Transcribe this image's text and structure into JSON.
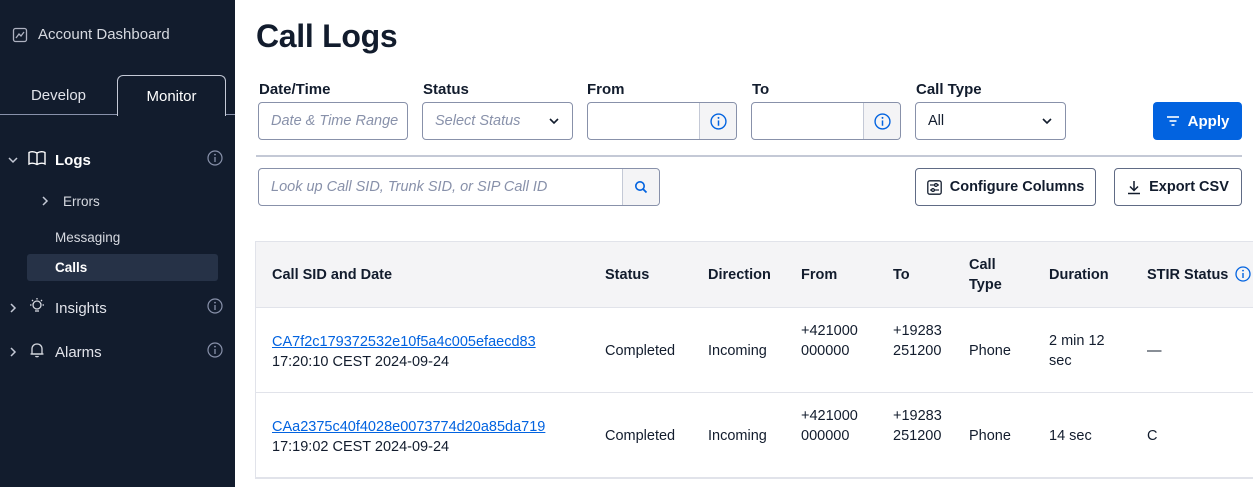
{
  "sidebar": {
    "account_dashboard": "Account Dashboard",
    "tabs": {
      "develop": "Develop",
      "monitor": "Monitor"
    },
    "logs": "Logs",
    "errors": "Errors",
    "messaging": "Messaging",
    "calls": "Calls",
    "insights": "Insights",
    "alarms": "Alarms"
  },
  "page": {
    "title": "Call Logs"
  },
  "filters": {
    "datetime": {
      "label": "Date/Time",
      "placeholder": "Date & Time Range"
    },
    "status": {
      "label": "Status",
      "placeholder": "Select Status"
    },
    "from": {
      "label": "From",
      "value": ""
    },
    "to": {
      "label": "To",
      "value": ""
    },
    "call_type": {
      "label": "Call Type",
      "value": "All"
    },
    "apply_label": "Apply"
  },
  "search": {
    "placeholder": "Look up Call SID, Trunk SID, or SIP Call ID"
  },
  "toolbar": {
    "configure_columns": "Configure Columns",
    "export_csv": "Export CSV"
  },
  "table": {
    "headers": {
      "sid_date": "Call SID and Date",
      "status": "Status",
      "direction": "Direction",
      "from": "From",
      "to": "To",
      "call_type": "Call Type",
      "duration": "Duration",
      "stir_status": "STIR Status"
    },
    "rows": [
      {
        "sid": "CA7f2c179372532e10f5a4c005efaecd83",
        "date": "17:20:10 CEST 2024-09-24",
        "status": "Completed",
        "direction": "Incoming",
        "from": "+421000000000",
        "to": "+19283251200",
        "call_type": "Phone",
        "duration": "2 min 12 sec",
        "stir_status": "—"
      },
      {
        "sid": "CAa2375c40f4028e0073774d20a85da719",
        "date": "17:19:02 CEST 2024-09-24",
        "status": "Completed",
        "direction": "Incoming",
        "from": "+421000000000",
        "to": "+19283251200",
        "call_type": "Phone",
        "duration": "14 sec",
        "stir_status": "C"
      }
    ]
  },
  "colors": {
    "sidebar_bg": "#121c2d",
    "accent": "#0263e0",
    "active_nav": "#263247"
  },
  "icons": {
    "account": "chart-line-icon",
    "logs": "book-icon",
    "insights": "lightbulb-icon",
    "alarms": "bell-icon",
    "info": "info-icon",
    "search": "search-icon",
    "filter": "filter-icon",
    "configure": "sliders-icon",
    "export": "download-icon"
  }
}
